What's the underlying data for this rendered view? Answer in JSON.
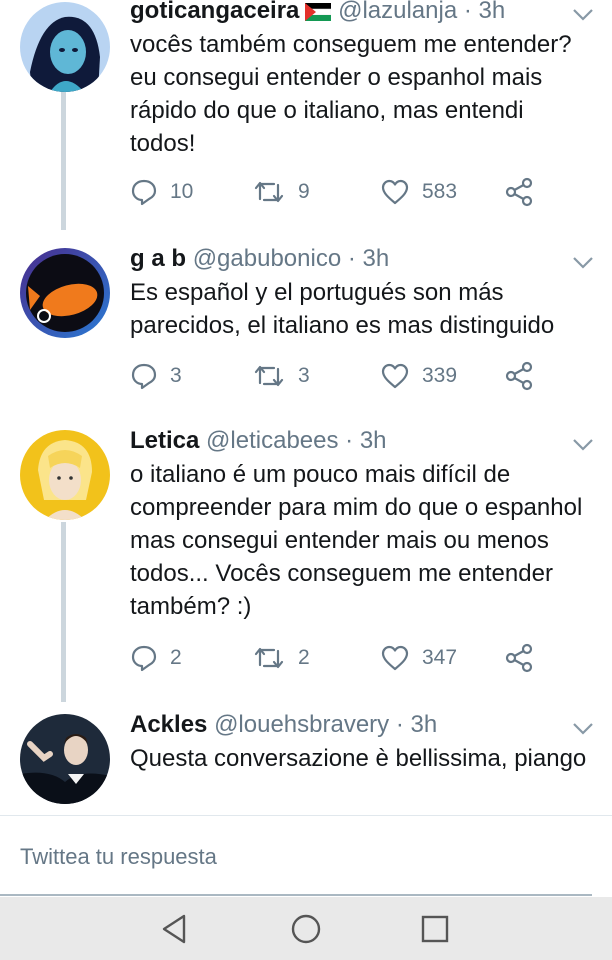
{
  "tweets": [
    {
      "name": "goticangaceira",
      "handle": "@lazulanja",
      "time": "3h",
      "text": "vocês também conseguem me entender? eu consegui entender o espanhol mais rápido do que o italiano, mas entendi todos!",
      "replies": "10",
      "retweets": "9",
      "likes": "583"
    },
    {
      "name": "g a b",
      "handle": "@gabubonico",
      "time": "3h",
      "text": "Es español y el portugués son más parecidos, el italiano es mas distinguido",
      "replies": "3",
      "retweets": "3",
      "likes": "339"
    },
    {
      "name": "Letica",
      "handle": "@leticabees",
      "time": "3h",
      "text": "o italiano é um pouco mais difícil de compreender para mim do que o espanhol mas consegui entender mais ou menos todos... Vocês conseguem me entender também? :)",
      "replies": "2",
      "retweets": "2",
      "likes": "347"
    },
    {
      "name": "Ackles",
      "handle": "@louehsbravery",
      "time": "3h",
      "text": "Questa conversazione è bellissima, piango"
    }
  ],
  "separator": "·",
  "reply_placeholder": "Twittea tu respuesta",
  "icons": {
    "reply": "reply-icon",
    "retweet": "retweet-icon",
    "like": "heart-icon",
    "share": "share-icon",
    "menu": "chevron-down-icon",
    "nav_back": "back-triangle-icon",
    "nav_home": "home-circle-icon",
    "nav_recents": "recents-square-icon"
  },
  "colors": {
    "text": "#14171a",
    "secondary": "#657786",
    "thread_line": "#ccd6dd",
    "nav_bg": "#e9e9e9"
  }
}
